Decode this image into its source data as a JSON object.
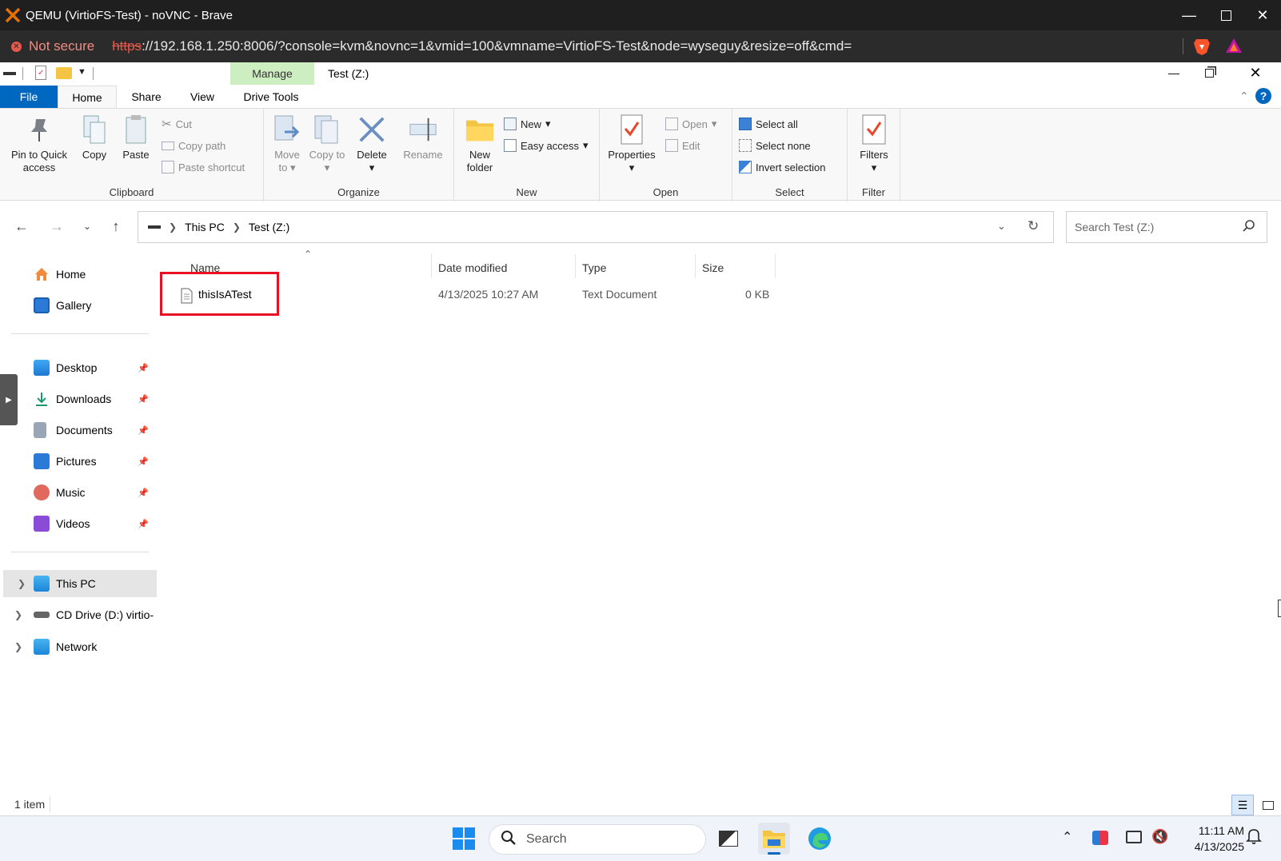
{
  "browser": {
    "title": "QEMU (VirtioFS-Test) - noVNC - Brave",
    "security": "Not secure",
    "url_scheme": "https",
    "url_rest": "://192.168.1.250:8006/?console=kvm&novnc=1&vmid=100&vmname=VirtioFS-Test&node=wyseguy&resize=off&cmd="
  },
  "explorer": {
    "window_title": "Test (Z:)",
    "context_tab": "Manage",
    "tabs": [
      "File",
      "Home",
      "Share",
      "View",
      "Drive Tools"
    ],
    "ribbon": {
      "clipboard": {
        "label": "Clipboard",
        "pin": "Pin to Quick access",
        "copy": "Copy",
        "paste": "Paste",
        "cut": "Cut",
        "copy_path": "Copy path",
        "paste_shortcut": "Paste shortcut"
      },
      "organize": {
        "label": "Organize",
        "move_to": "Move to",
        "copy_to": "Copy to",
        "delete": "Delete",
        "rename": "Rename"
      },
      "new": {
        "label": "New",
        "new_folder": "New folder",
        "new_item": "New",
        "easy_access": "Easy access"
      },
      "open": {
        "label": "Open",
        "properties": "Properties",
        "open": "Open",
        "edit": "Edit"
      },
      "select": {
        "label": "Select",
        "select_all": "Select all",
        "select_none": "Select none",
        "invert": "Invert selection"
      },
      "filter": {
        "label": "Filter",
        "filters": "Filters"
      }
    },
    "breadcrumb": [
      "This PC",
      "Test (Z:)"
    ],
    "search_placeholder": "Search Test (Z:)",
    "sidebar": {
      "home": "Home",
      "gallery": "Gallery",
      "pinned": [
        "Desktop",
        "Downloads",
        "Documents",
        "Pictures",
        "Music",
        "Videos"
      ],
      "this_pc": "This PC",
      "cd_drive": "CD Drive (D:) virtio-",
      "network": "Network"
    },
    "columns": {
      "name": "Name",
      "date": "Date modified",
      "type": "Type",
      "size": "Size"
    },
    "files": [
      {
        "name": "thisIsATest",
        "date": "4/13/2025 10:27 AM",
        "type": "Text Document",
        "size": "0 KB"
      }
    ],
    "status": "1 item"
  },
  "taskbar": {
    "search": "Search",
    "time": "11:11 AM",
    "date": "4/13/2025"
  },
  "colors": {
    "accent": "#0067c0",
    "highlight_box": "#e81123",
    "manage_tab": "#cdeec0"
  }
}
